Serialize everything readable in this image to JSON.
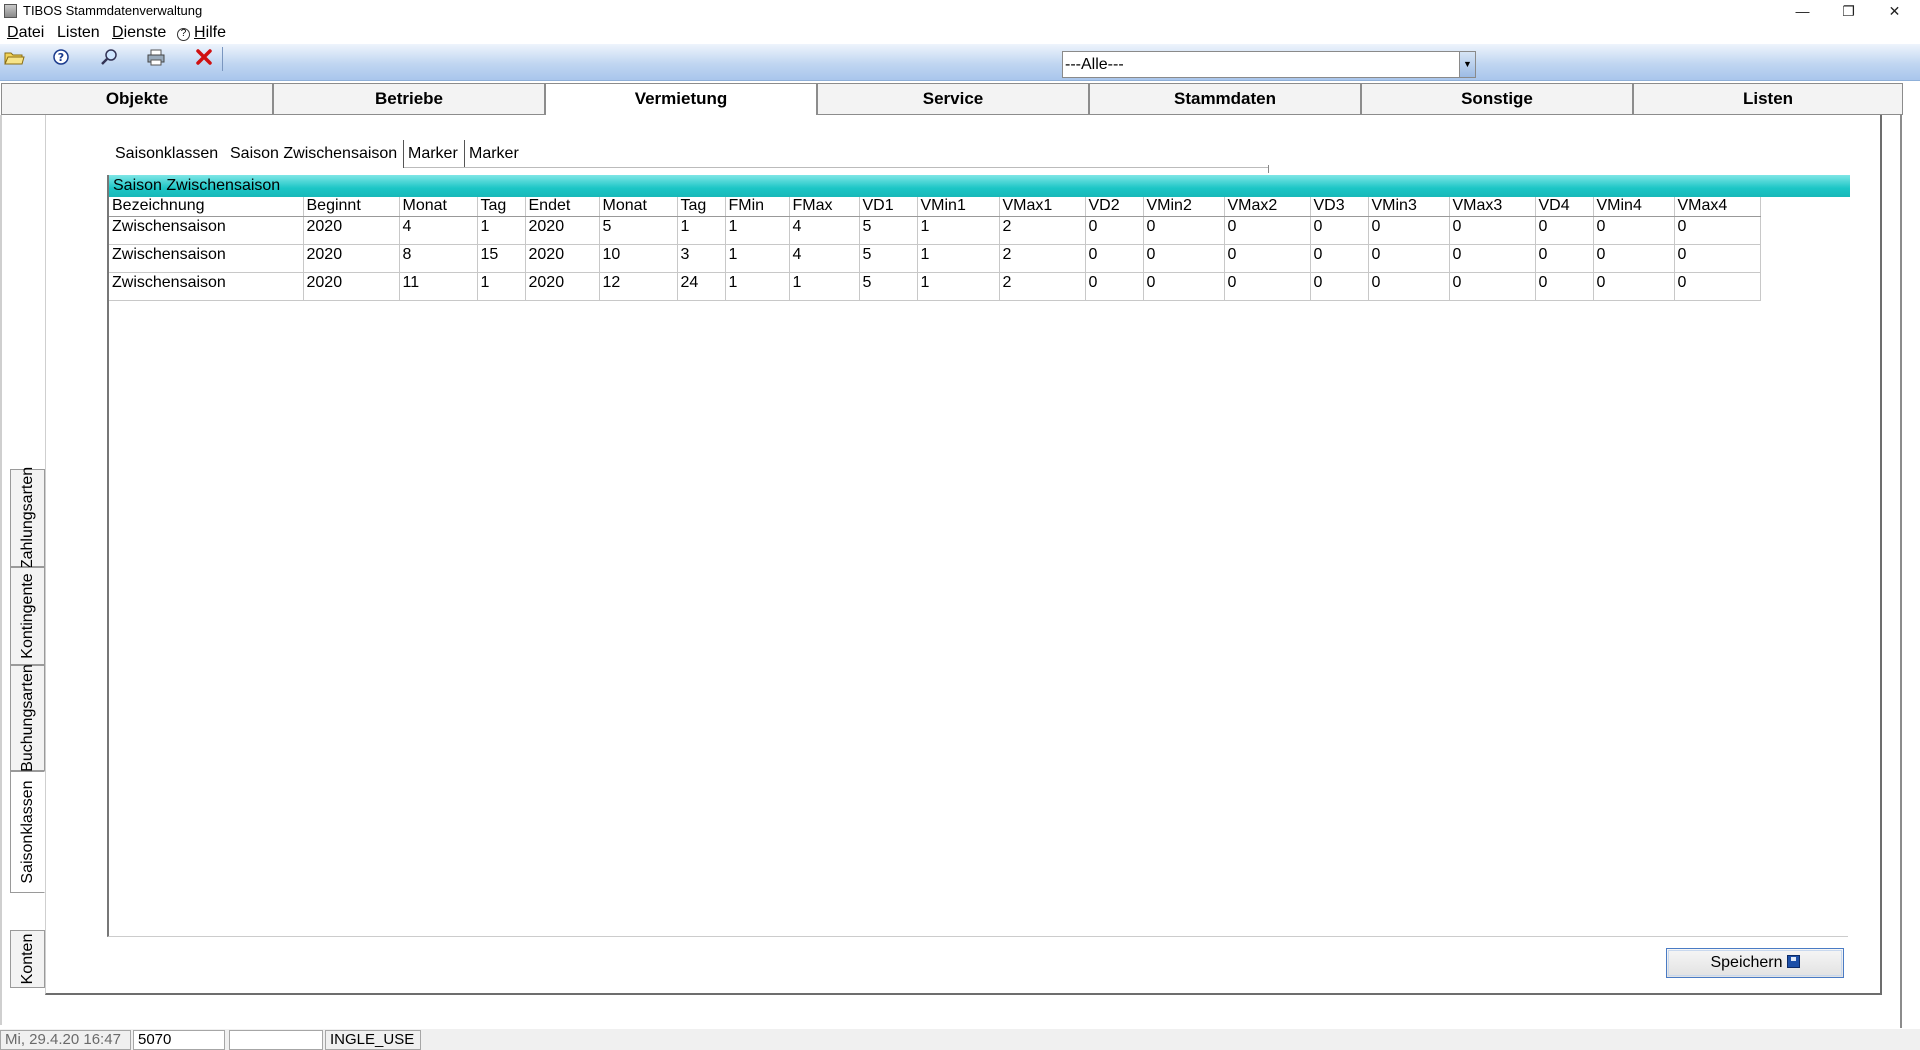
{
  "window": {
    "title": "TIBOS Stammdatenverwaltung"
  },
  "menu": {
    "datei": "Datei",
    "listen": "Listen",
    "dienste": "Dienste",
    "hilfe": "Hilfe"
  },
  "toolbar": {
    "icons": [
      "open-folder-icon",
      "help-icon",
      "search-icon",
      "print-icon",
      "delete-icon"
    ],
    "filter_value": "---Alle---"
  },
  "main_tabs": [
    "Objekte",
    "Betriebe",
    "Vermietung",
    "Service",
    "Stammdaten",
    "Sonstige",
    "Listen"
  ],
  "main_tab_active": "Vermietung",
  "side_tabs": [
    "Konten",
    "Saisonklassen",
    "Buchungsarten",
    "Kontingente",
    "Zahlungsarten"
  ],
  "side_tab_active": "Saisonklassen",
  "sub_tabs": [
    "Saisonklassen",
    "Saison Zwischensaison",
    "Marker",
    "Marker"
  ],
  "sub_tab_active": "Saison Zwischensaison",
  "panel": {
    "title": "Saison Zwischensaison",
    "columns": [
      "Bezeichnung",
      "Beginnt",
      "Monat",
      "Tag",
      "Endet",
      "Monat",
      "Tag",
      "FMin",
      "FMax",
      "VD1",
      "VMin1",
      "VMax1",
      "VD2",
      "VMin2",
      "VMax2",
      "VD3",
      "VMin3",
      "VMax3",
      "VD4",
      "VMin4",
      "VMax4"
    ],
    "rows": [
      [
        "Zwischensaison",
        "2020",
        "4",
        "1",
        "2020",
        "5",
        "1",
        "1",
        "4",
        "5",
        "1",
        "2",
        "0",
        "0",
        "0",
        "0",
        "0",
        "0",
        "0",
        "0",
        "0"
      ],
      [
        "Zwischensaison",
        "2020",
        "8",
        "15",
        "2020",
        "10",
        "3",
        "1",
        "4",
        "5",
        "1",
        "2",
        "0",
        "0",
        "0",
        "0",
        "0",
        "0",
        "0",
        "0",
        "0"
      ],
      [
        "Zwischensaison",
        "2020",
        "11",
        "1",
        "2020",
        "12",
        "24",
        "1",
        "1",
        "5",
        "1",
        "2",
        "0",
        "0",
        "0",
        "0",
        "0",
        "0",
        "0",
        "0",
        "0"
      ]
    ]
  },
  "save_button": "Speichern",
  "status": {
    "datetime": "Mi, 29.4.20 16:47",
    "code": "5070",
    "empty": "",
    "user": "INGLE_USE"
  }
}
